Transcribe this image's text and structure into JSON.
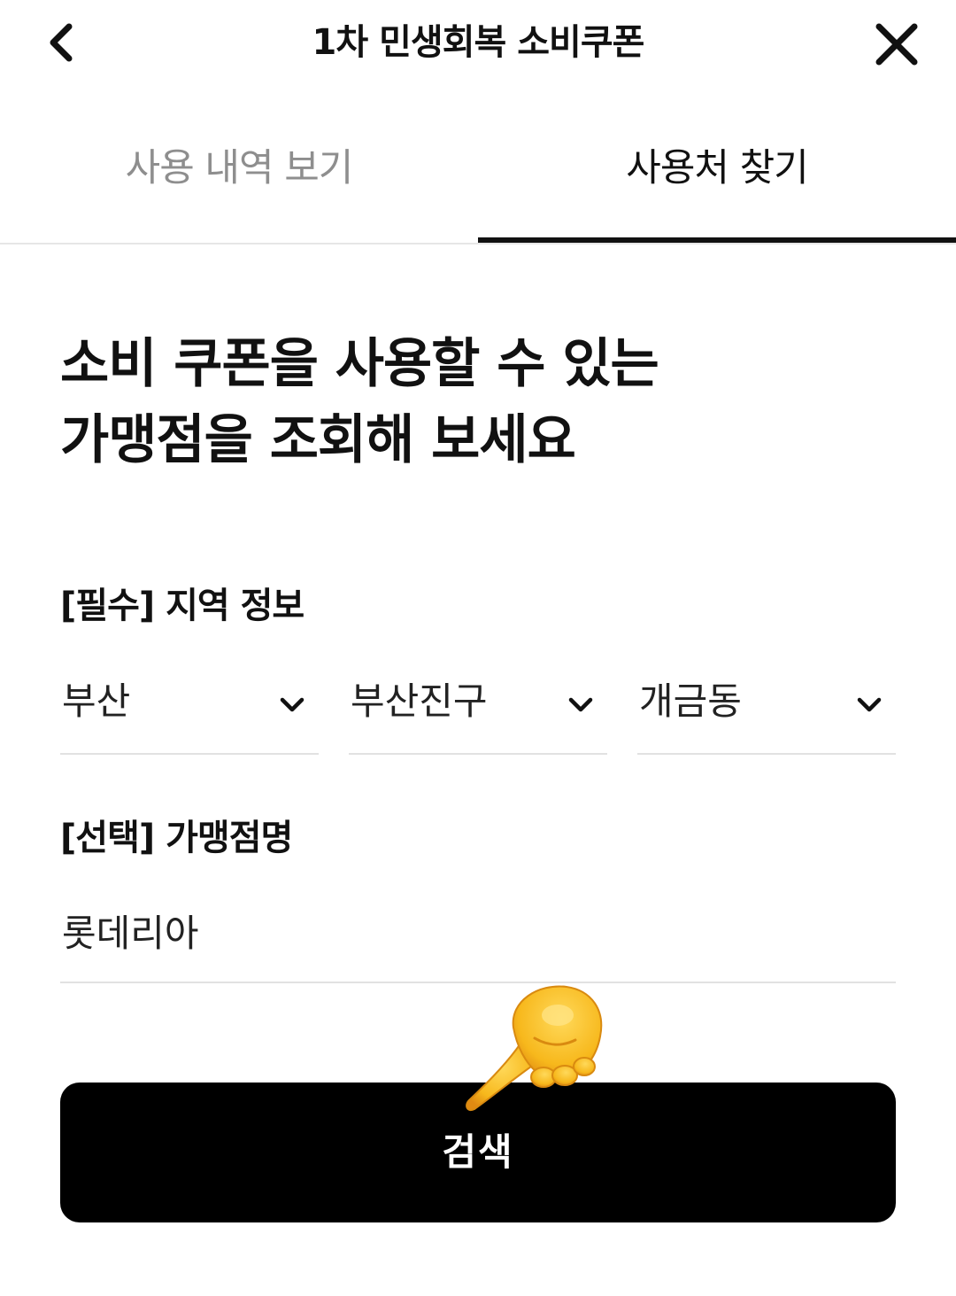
{
  "header": {
    "title": "1차 민생회복 소비쿠폰",
    "back_icon": "chevron-left-icon",
    "close_icon": "close-icon"
  },
  "tabs": [
    {
      "label": "사용 내역 보기",
      "active": false
    },
    {
      "label": "사용처 찾기",
      "active": true
    }
  ],
  "main": {
    "headline_line1": "소비 쿠폰을 사용할 수 있는",
    "headline_line2": "가맹점을 조회해 보세요",
    "region": {
      "label": "[필수] 지역 정보",
      "city": "부산",
      "district": "부산진구",
      "dong": "개금동"
    },
    "store": {
      "label": "[선택] 가맹점명",
      "value": "롯데리아"
    },
    "search_label": "검색"
  },
  "overlay": {
    "emoji": "backhand-index-pointing-down",
    "colors": {
      "skin": "#f7b81c",
      "skin_dark": "#e08a12"
    }
  }
}
